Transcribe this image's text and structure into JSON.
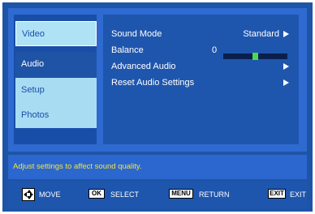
{
  "menu": {
    "tabs": [
      {
        "label": "Video",
        "state": "light"
      },
      {
        "label": "Audio",
        "state": "active"
      },
      {
        "label": "Setup",
        "state": "light"
      },
      {
        "label": "Photos",
        "state": "light"
      }
    ]
  },
  "settings": {
    "sound_mode": {
      "label": "Sound Mode",
      "value": "Standard"
    },
    "balance": {
      "label": "Balance",
      "value": "0",
      "level_fraction": 0.5
    },
    "advanced_audio": {
      "label": "Advanced Audio"
    },
    "reset_audio": {
      "label": "Reset Audio Settings"
    }
  },
  "help_text": "Adjust settings to affect sound quality.",
  "footer": {
    "move_label": "MOVE",
    "ok_key": "OK",
    "select_label": "SELECT",
    "menu_key": "MENU",
    "return_label": "RETURN",
    "exit_key": "EXIT",
    "exit_label": "EXIT"
  },
  "colors": {
    "frame": "#1e54a6",
    "panel": "#2e6ad0",
    "tab_light": "#a8dcf3",
    "help_text": "#f2e63b",
    "balance_knob": "#4dd94f"
  }
}
